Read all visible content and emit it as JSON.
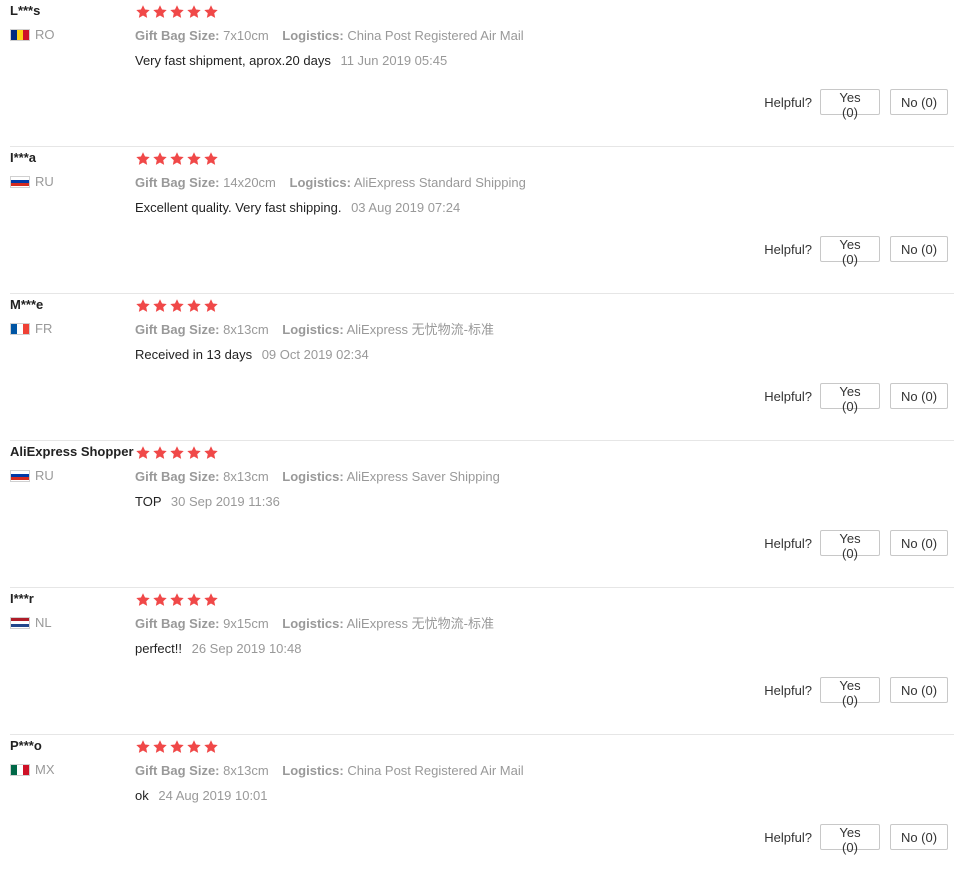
{
  "labels": {
    "gift_bag_size": "Gift Bag Size:",
    "logistics": "Logistics:",
    "helpful": "Helpful?"
  },
  "star_color": "#f04848",
  "reviews": [
    {
      "user": "L***s",
      "country": "RO",
      "flag_colors": [
        "#002b7f",
        "#fcd116",
        "#ce1126"
      ],
      "flag_orientation": "vertical",
      "rating": 5,
      "gift_bag_size": "7x10cm",
      "logistics": "China Post Registered Air Mail",
      "text": "Very fast shipment, aprox.20 days",
      "date": "11 Jun 2019 05:45",
      "yes": "Yes (0)",
      "no": "No (0)"
    },
    {
      "user": "I***a",
      "country": "RU",
      "flag_colors": [
        "#ffffff",
        "#0039a6",
        "#d52b1e"
      ],
      "flag_orientation": "horizontal",
      "rating": 5,
      "gift_bag_size": "14x20cm",
      "logistics": "AliExpress Standard Shipping",
      "text": "Excellent quality. Very fast shipping.",
      "date": "03 Aug 2019 07:24",
      "yes": "Yes (0)",
      "no": "No (0)"
    },
    {
      "user": "M***e",
      "country": "FR",
      "flag_colors": [
        "#0055a4",
        "#ffffff",
        "#ef4135"
      ],
      "flag_orientation": "vertical",
      "rating": 5,
      "gift_bag_size": "8x13cm",
      "logistics": "AliExpress 无忧物流-标准",
      "text": "Received in 13 days",
      "date": "09 Oct 2019 02:34",
      "yes": "Yes (0)",
      "no": "No (0)"
    },
    {
      "user": "AliExpress Shopper",
      "country": "RU",
      "flag_colors": [
        "#ffffff",
        "#0039a6",
        "#d52b1e"
      ],
      "flag_orientation": "horizontal",
      "rating": 5,
      "gift_bag_size": "8x13cm",
      "logistics": "AliExpress Saver Shipping",
      "text": "TOP",
      "date": "30 Sep 2019 11:36",
      "yes": "Yes (0)",
      "no": "No (0)"
    },
    {
      "user": "I***r",
      "country": "NL",
      "flag_colors": [
        "#ae1c28",
        "#ffffff",
        "#21468b"
      ],
      "flag_orientation": "horizontal",
      "rating": 5,
      "gift_bag_size": "9x15cm",
      "logistics": "AliExpress 无忧物流-标准",
      "text": "perfect!!",
      "date": "26 Sep 2019 10:48",
      "yes": "Yes (0)",
      "no": "No (0)"
    },
    {
      "user": "P***o",
      "country": "MX",
      "flag_colors": [
        "#006847",
        "#ffffff",
        "#ce1126"
      ],
      "flag_orientation": "vertical",
      "rating": 5,
      "gift_bag_size": "8x13cm",
      "logistics": "China Post Registered Air Mail",
      "text": "ok",
      "date": "24 Aug 2019 10:01",
      "yes": "Yes (0)",
      "no": "No (0)"
    }
  ]
}
